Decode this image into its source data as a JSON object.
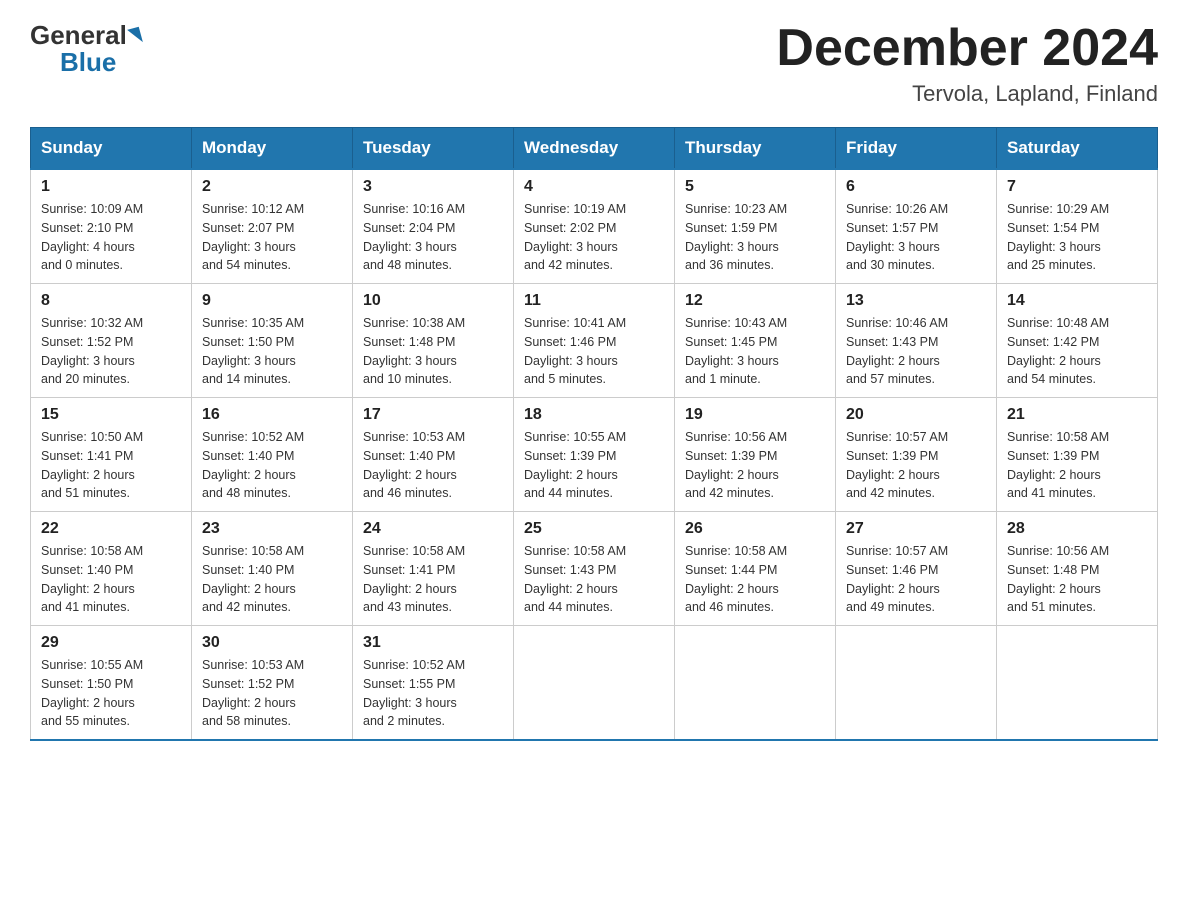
{
  "header": {
    "logo_general": "General",
    "logo_blue": "Blue",
    "month_title": "December 2024",
    "location": "Tervola, Lapland, Finland"
  },
  "weekdays": [
    "Sunday",
    "Monday",
    "Tuesday",
    "Wednesday",
    "Thursday",
    "Friday",
    "Saturday"
  ],
  "weeks": [
    [
      {
        "day": "1",
        "sunrise": "10:09 AM",
        "sunset": "2:10 PM",
        "daylight": "4 hours and 0 minutes."
      },
      {
        "day": "2",
        "sunrise": "10:12 AM",
        "sunset": "2:07 PM",
        "daylight": "3 hours and 54 minutes."
      },
      {
        "day": "3",
        "sunrise": "10:16 AM",
        "sunset": "2:04 PM",
        "daylight": "3 hours and 48 minutes."
      },
      {
        "day": "4",
        "sunrise": "10:19 AM",
        "sunset": "2:02 PM",
        "daylight": "3 hours and 42 minutes."
      },
      {
        "day": "5",
        "sunrise": "10:23 AM",
        "sunset": "1:59 PM",
        "daylight": "3 hours and 36 minutes."
      },
      {
        "day": "6",
        "sunrise": "10:26 AM",
        "sunset": "1:57 PM",
        "daylight": "3 hours and 30 minutes."
      },
      {
        "day": "7",
        "sunrise": "10:29 AM",
        "sunset": "1:54 PM",
        "daylight": "3 hours and 25 minutes."
      }
    ],
    [
      {
        "day": "8",
        "sunrise": "10:32 AM",
        "sunset": "1:52 PM",
        "daylight": "3 hours and 20 minutes."
      },
      {
        "day": "9",
        "sunrise": "10:35 AM",
        "sunset": "1:50 PM",
        "daylight": "3 hours and 14 minutes."
      },
      {
        "day": "10",
        "sunrise": "10:38 AM",
        "sunset": "1:48 PM",
        "daylight": "3 hours and 10 minutes."
      },
      {
        "day": "11",
        "sunrise": "10:41 AM",
        "sunset": "1:46 PM",
        "daylight": "3 hours and 5 minutes."
      },
      {
        "day": "12",
        "sunrise": "10:43 AM",
        "sunset": "1:45 PM",
        "daylight": "3 hours and 1 minute."
      },
      {
        "day": "13",
        "sunrise": "10:46 AM",
        "sunset": "1:43 PM",
        "daylight": "2 hours and 57 minutes."
      },
      {
        "day": "14",
        "sunrise": "10:48 AM",
        "sunset": "1:42 PM",
        "daylight": "2 hours and 54 minutes."
      }
    ],
    [
      {
        "day": "15",
        "sunrise": "10:50 AM",
        "sunset": "1:41 PM",
        "daylight": "2 hours and 51 minutes."
      },
      {
        "day": "16",
        "sunrise": "10:52 AM",
        "sunset": "1:40 PM",
        "daylight": "2 hours and 48 minutes."
      },
      {
        "day": "17",
        "sunrise": "10:53 AM",
        "sunset": "1:40 PM",
        "daylight": "2 hours and 46 minutes."
      },
      {
        "day": "18",
        "sunrise": "10:55 AM",
        "sunset": "1:39 PM",
        "daylight": "2 hours and 44 minutes."
      },
      {
        "day": "19",
        "sunrise": "10:56 AM",
        "sunset": "1:39 PM",
        "daylight": "2 hours and 42 minutes."
      },
      {
        "day": "20",
        "sunrise": "10:57 AM",
        "sunset": "1:39 PM",
        "daylight": "2 hours and 42 minutes."
      },
      {
        "day": "21",
        "sunrise": "10:58 AM",
        "sunset": "1:39 PM",
        "daylight": "2 hours and 41 minutes."
      }
    ],
    [
      {
        "day": "22",
        "sunrise": "10:58 AM",
        "sunset": "1:40 PM",
        "daylight": "2 hours and 41 minutes."
      },
      {
        "day": "23",
        "sunrise": "10:58 AM",
        "sunset": "1:40 PM",
        "daylight": "2 hours and 42 minutes."
      },
      {
        "day": "24",
        "sunrise": "10:58 AM",
        "sunset": "1:41 PM",
        "daylight": "2 hours and 43 minutes."
      },
      {
        "day": "25",
        "sunrise": "10:58 AM",
        "sunset": "1:43 PM",
        "daylight": "2 hours and 44 minutes."
      },
      {
        "day": "26",
        "sunrise": "10:58 AM",
        "sunset": "1:44 PM",
        "daylight": "2 hours and 46 minutes."
      },
      {
        "day": "27",
        "sunrise": "10:57 AM",
        "sunset": "1:46 PM",
        "daylight": "2 hours and 49 minutes."
      },
      {
        "day": "28",
        "sunrise": "10:56 AM",
        "sunset": "1:48 PM",
        "daylight": "2 hours and 51 minutes."
      }
    ],
    [
      {
        "day": "29",
        "sunrise": "10:55 AM",
        "sunset": "1:50 PM",
        "daylight": "2 hours and 55 minutes."
      },
      {
        "day": "30",
        "sunrise": "10:53 AM",
        "sunset": "1:52 PM",
        "daylight": "2 hours and 58 minutes."
      },
      {
        "day": "31",
        "sunrise": "10:52 AM",
        "sunset": "1:55 PM",
        "daylight": "3 hours and 2 minutes."
      },
      null,
      null,
      null,
      null
    ]
  ],
  "labels": {
    "sunrise": "Sunrise:",
    "sunset": "Sunset:",
    "daylight": "Daylight:"
  }
}
